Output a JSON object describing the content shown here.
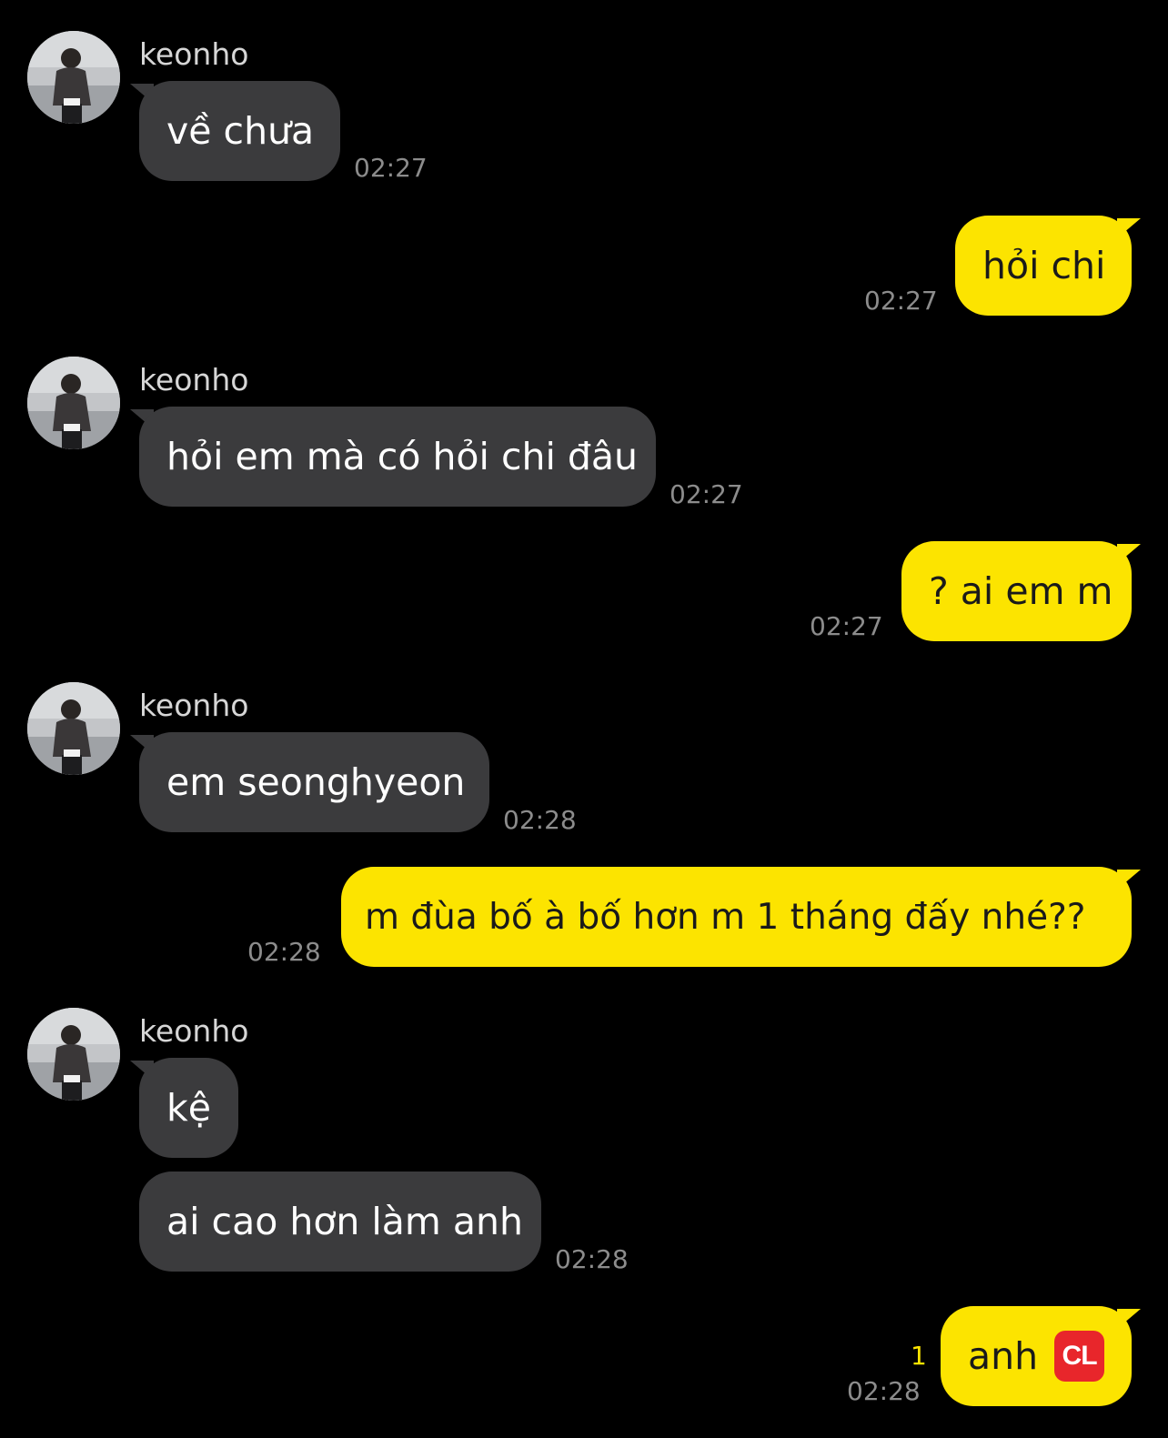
{
  "contact": {
    "name": "keonho"
  },
  "messages": [
    {
      "side": "in",
      "text": "về chưa",
      "time": "02:27",
      "show_sender": true
    },
    {
      "side": "out",
      "text": "hỏi chi",
      "time": "02:27"
    },
    {
      "side": "in",
      "text": "hỏi em mà có hỏi chi đâu",
      "time": "02:27",
      "show_sender": true
    },
    {
      "side": "out",
      "text": "? ai em m",
      "time": "02:27"
    },
    {
      "side": "in",
      "text": "em seonghyeon",
      "time": "02:28",
      "show_sender": true
    },
    {
      "side": "out",
      "text": "m đùa bố à bố hơn m 1 tháng đấy nhé??",
      "time": "02:28"
    },
    {
      "side": "in",
      "text": "kệ",
      "show_sender": true
    },
    {
      "side": "in",
      "text": "ai cao hơn làm anh",
      "time": "02:28"
    },
    {
      "side": "out",
      "text": "anh",
      "emoji": "CL",
      "time": "02:28",
      "unread": "1"
    }
  ]
}
